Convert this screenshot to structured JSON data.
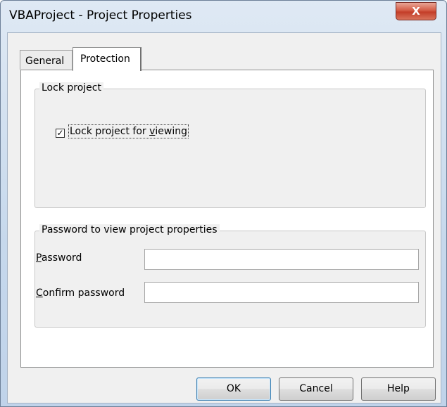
{
  "window": {
    "title": "VBAProject - Project Properties",
    "close_glyph": "X"
  },
  "tabs": [
    {
      "label": "General",
      "selected": false
    },
    {
      "label": "Protection",
      "selected": true
    }
  ],
  "lock_group": {
    "legend": "Lock project",
    "checkbox": {
      "label_prefix": "Lock project for ",
      "label_mnemonic": "v",
      "label_suffix": "iewing",
      "checked": true,
      "glyph": "✓"
    }
  },
  "password_group": {
    "legend": "Password to view project properties",
    "password": {
      "label_mnemonic": "P",
      "label_rest": "assword",
      "value": ""
    },
    "confirm": {
      "label_mnemonic": "C",
      "label_rest": "onfirm password",
      "value": ""
    }
  },
  "buttons": {
    "ok": "OK",
    "cancel": "Cancel",
    "help": "Help"
  }
}
